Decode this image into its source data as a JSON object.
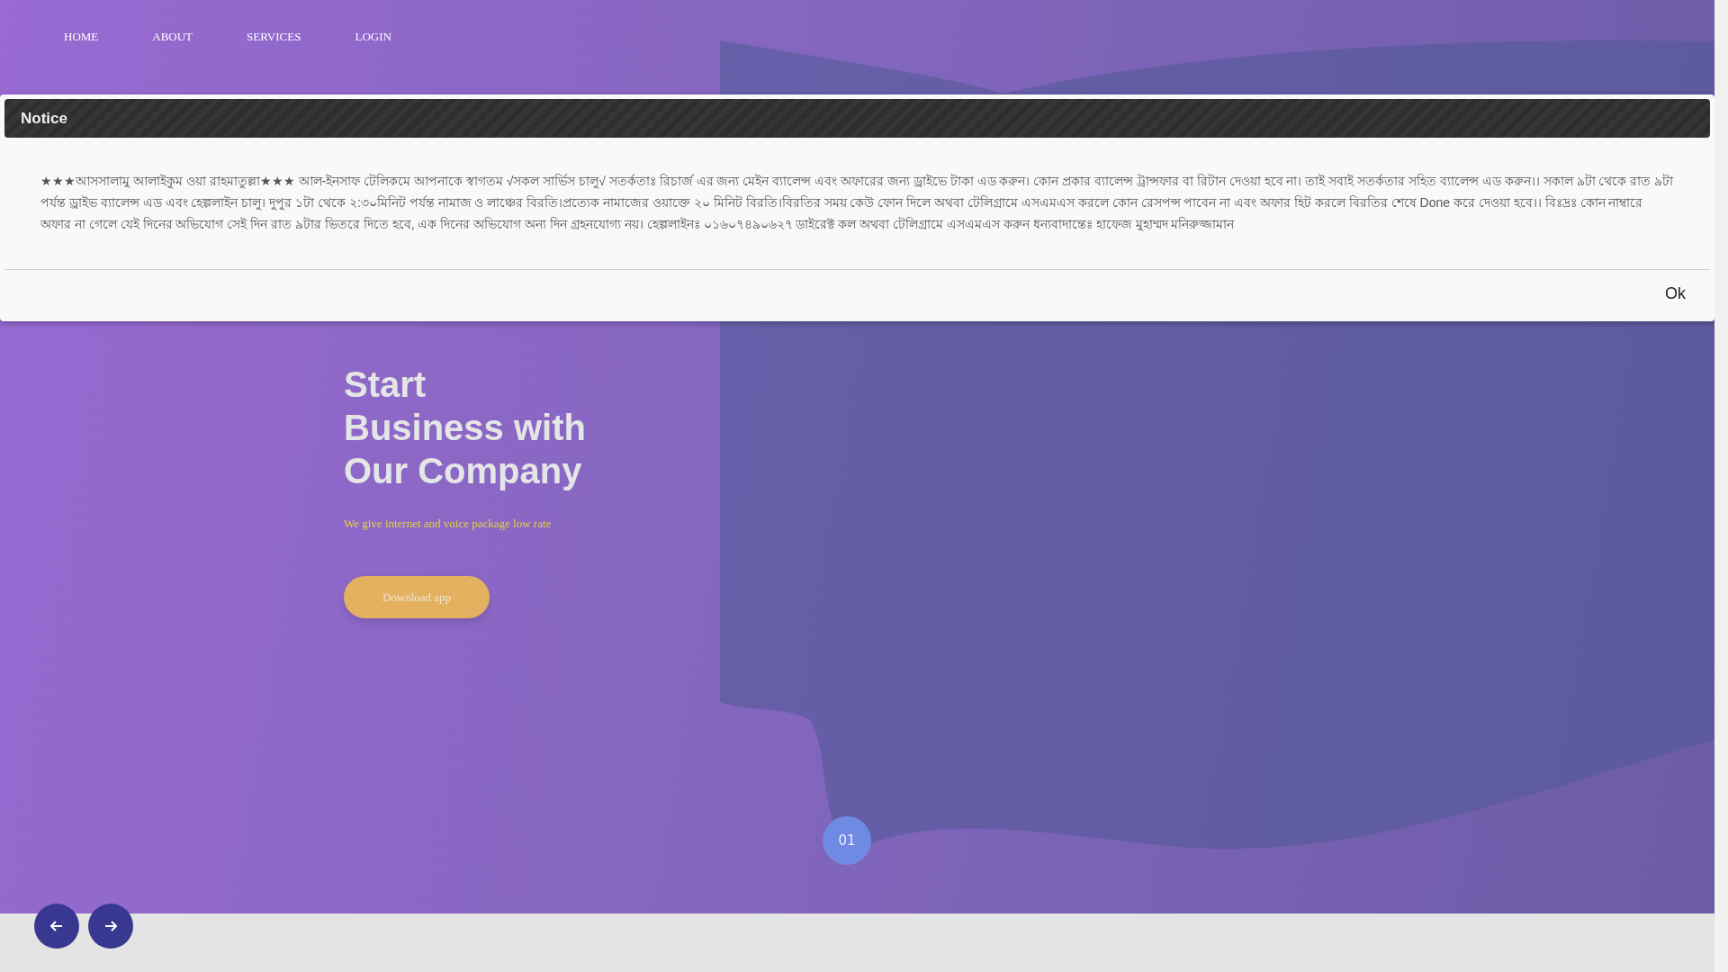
{
  "nav": [
    {
      "label": "HOME"
    },
    {
      "label": "ABOUT"
    },
    {
      "label": "SERVICES"
    },
    {
      "label": "LOGIN"
    }
  ],
  "notice": {
    "title": "Notice",
    "message": "★★★আসসালামু আলাইকুম ওয়া রাহমাতুল্লা★★★ আল-ইনসাফ টেলিকমে আপনাকে স্বাগতম √সকল সার্ভিস চালু√ সতর্কতাঃ রিচার্জ এর জন্য মেইন ব্যালেন্স এবং অফারের জন্য ড্রাইভে টাকা এড করুন। কোন প্রকার ব্যালেন্স ট্রান্সফার বা রিটান দেওয়া হবে না। তাই সবাই সতর্কতার সহিত ব্যালেন্স এড করুন।। সকাল ৯টা থেকে রাত ৯টা পর্যন্ত ড্রাইভ ব্যালেন্স এড এবং হেল্পলাইন চালু। দুপুর ১টা থেকে ২:৩০মিনিট পর্যন্ত নামাজ ও লাঞ্চের বিরতি।প্রত্যেক নামাজের ওয়াক্তে ২০ মিনিট বিরতি।বিরতির সময় কেউ ফোন দিলে অথবা টেলিগ্রামে এসএমএস করলে কোন রেসপন্স পাবেন না এবং অফার হিট করলে বিরতির শেষে Done করে দেওয়া হবে।। বিঃদ্রঃ কোন নাম্বারে অফার না গেলে যেই দিনের অভিযোগ সেই দিন রাত ৯টার ভিতরে দিতে হবে, এক দিনের অভিযোগ অন্য দিন গ্রহনযোগ্য নয়। হেল্পলাইনঃ ০১৬০৭৪৯০৬২৭ ডাইরেক্ট কল অথবা টেলিগ্রামে এসএমএস করুন ধন্যবাদান্তেঃ হাফেজ মুহাম্মদ মনিরুজ্জামান",
    "button": "Ok"
  },
  "hero": {
    "heading_lines": [
      "Start",
      "Business with",
      "Our Company"
    ],
    "tagline": "We give internet and voice package low rate",
    "button": "Download app"
  },
  "slider": {
    "page": "01"
  }
}
